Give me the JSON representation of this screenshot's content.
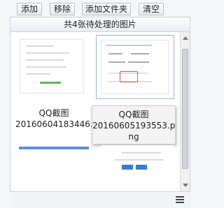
{
  "header": {
    "title": "共4张待处理的图片"
  },
  "tiles": [
    {
      "caption_line1": "QQ截图",
      "caption_line2": "20160604183446..."
    },
    {
      "tooltip_line1": "QQ截图",
      "tooltip_line2": "20160605193553.p",
      "tooltip_line3": "ng"
    }
  ],
  "toolbar": {
    "add_label": "添加",
    "remove_label": "移除",
    "add_folder_label": "添加文件夹",
    "clear_label": "清空"
  },
  "icons": {
    "list_view": "list-view-icon"
  },
  "colors": {
    "accent": "#5b8fd8",
    "green": "#58b957"
  }
}
